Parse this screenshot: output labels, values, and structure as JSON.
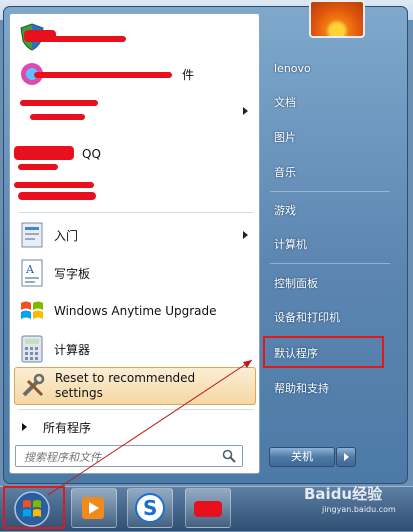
{
  "start_menu": {
    "programs": [
      {
        "label": "",
        "icon": "security-shield-icon",
        "obscured": true
      },
      {
        "label": "件",
        "icon": "media-app-icon",
        "obscured": true
      },
      {
        "label": "",
        "icon": "app-icon",
        "obscured": true,
        "has_submenu": true
      },
      {
        "label": "QQ",
        "icon": "qq-icon",
        "obscured": true
      },
      {
        "label": "",
        "icon": "app-icon",
        "obscured": true
      },
      {
        "label": "入门",
        "icon": "getting-started-icon",
        "has_submenu": true
      },
      {
        "label": "写字板",
        "icon": "wordpad-icon"
      },
      {
        "label": "Windows Anytime Upgrade",
        "icon": "windows-flag-icon"
      },
      {
        "label": "计算器",
        "icon": "calculator-icon"
      },
      {
        "label": "Reset to recommended settings",
        "icon": "tools-icon",
        "highlighted": true
      }
    ],
    "all_programs": "所有程序",
    "search_placeholder": "搜索程序和文件"
  },
  "right_pane": {
    "items": [
      "lenovo",
      "文档",
      "图片",
      "音乐",
      "游戏",
      "计算机",
      "控制面板",
      "设备和打印机",
      "默认程序",
      "帮助和支持"
    ],
    "highlighted": "默认程序"
  },
  "shutdown": {
    "label": "关机"
  },
  "taskbar": {
    "buttons": [
      "start-orb",
      "media-player",
      "sogou",
      "app"
    ]
  },
  "watermark": {
    "text": "Baidu经验",
    "sub": "jingyan.baidu.com"
  },
  "colors": {
    "annotation": "#e01a1a",
    "highlight": "#f5d8a3",
    "menu_blue": "#5c86b1"
  }
}
